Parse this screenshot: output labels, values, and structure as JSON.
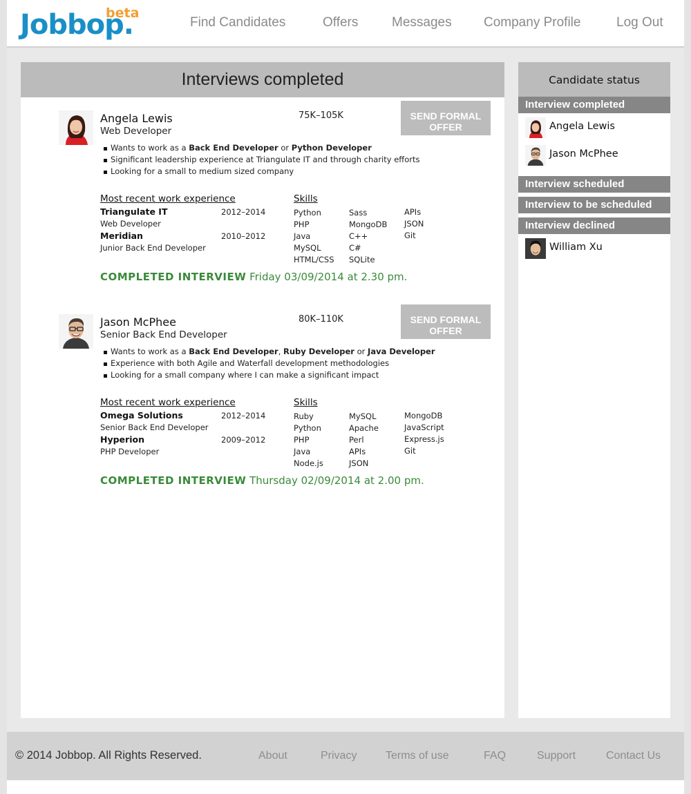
{
  "logo": {
    "main": "Jobbop.",
    "beta": "beta"
  },
  "nav": {
    "items": [
      {
        "label": "Find Candidates"
      },
      {
        "label": "Offers"
      },
      {
        "label": "Messages"
      },
      {
        "label": "Company Profile"
      },
      {
        "label": "Log Out"
      }
    ]
  },
  "main": {
    "title": "Interviews completed",
    "section_labels": {
      "experience": "Most recent work experience",
      "skills": "Skills"
    },
    "candidates": [
      {
        "name": "Angela Lewis",
        "role": "Web Developer",
        "salary": "75K–105K",
        "offer_button": "SEND FORMAL OFFER",
        "wants_prefix": "Wants to work as a",
        "wants_roles": [
          "Back End Developer",
          "Python Developer"
        ],
        "wants_sep": [
          "or"
        ],
        "bullets": [
          "Significant leadership experience at Triangulate IT and through charity efforts",
          "Looking for a small to medium sized company"
        ],
        "experience": [
          {
            "company": "Triangulate IT",
            "title": "Web Developer",
            "years": "2012–2014"
          },
          {
            "company": "Meridian",
            "title": "Junior Back End Developer",
            "years": "2010–2012"
          }
        ],
        "skills": [
          [
            "Python",
            "PHP",
            "Java",
            "MySQL",
            "HTML/CSS"
          ],
          [
            "Sass",
            "MongoDB",
            "C++",
            "C#",
            "SQLite"
          ],
          [
            "APIs",
            "JSON",
            "Git"
          ]
        ],
        "status_tag": "COMPLETED INTERVIEW",
        "status_date": "Friday 03/09/2014 at 2.30 pm."
      },
      {
        "name": "Jason McPhee",
        "role": "Senior Back End Developer",
        "salary": "80K–110K",
        "offer_button": "SEND FORMAL OFFER",
        "wants_prefix": "Wants to work as a",
        "wants_roles": [
          "Back End Developer",
          "Ruby Developer",
          "Java Developer"
        ],
        "wants_sep": [
          ",",
          "or"
        ],
        "bullets": [
          "Experience with both Agile and Waterfall development methodologies",
          "Looking for a small company where I can make a significant impact"
        ],
        "experience": [
          {
            "company": "Omega Solutions",
            "title": "Senior Back End Developer",
            "years": "2012–2014"
          },
          {
            "company": "Hyperion",
            "title": "PHP Developer",
            "years": "2009–2012"
          }
        ],
        "skills": [
          [
            "Ruby",
            "Python",
            "PHP",
            "Java",
            "Node.js"
          ],
          [
            "MySQL",
            "Apache",
            "Perl",
            "APIs",
            "JSON"
          ],
          [
            "MongoDB",
            "JavaScript",
            "Express.js",
            "Git"
          ]
        ],
        "status_tag": "COMPLETED INTERVIEW",
        "status_date": "Thursday 02/09/2014 at 2.00 pm."
      }
    ]
  },
  "sidebar": {
    "title": "Candidate status",
    "groups": [
      {
        "label": "Interview completed",
        "candidates": [
          "Angela Lewis",
          "Jason McPhee"
        ]
      },
      {
        "label": "Interview scheduled",
        "candidates": []
      },
      {
        "label": "Interview to be scheduled",
        "candidates": []
      },
      {
        "label": "Interview declined",
        "candidates": [
          "William Xu"
        ]
      }
    ]
  },
  "footer": {
    "copyright": "© 2014 Jobbop. All Rights Reserved.",
    "links": [
      {
        "label": "About"
      },
      {
        "label": "Privacy"
      },
      {
        "label": "Terms of use"
      },
      {
        "label": "FAQ"
      },
      {
        "label": "Support"
      },
      {
        "label": "Contact Us"
      }
    ]
  },
  "colors": {
    "brand": "#1a8fc7",
    "beta": "#f0a030",
    "status_green": "#3a8a3a",
    "panel_header": "#bbbbbb",
    "side_header": "#868686"
  }
}
